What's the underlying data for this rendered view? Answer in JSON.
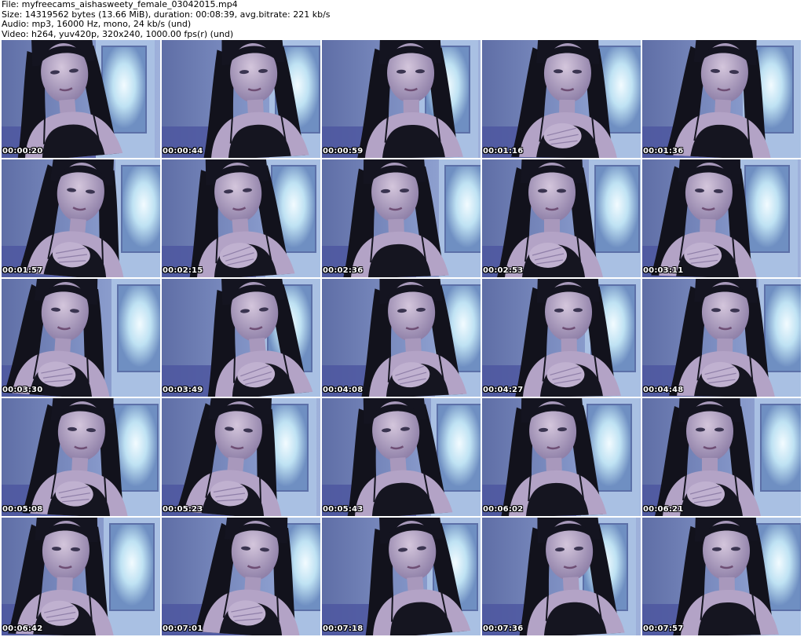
{
  "header": {
    "file_line": "File: myfreecams_aishasweety_female_03042015.mp4",
    "size_line": "Size: 14319562 bytes (13.66 MiB), duration: 00:08:39, avg.bitrate: 221 kb/s",
    "audio_line": "Audio: mp3, 16000 Hz, mono, 24 kb/s (und)",
    "video_line": "Video: h264, yuv420p, 320x240, 1000.00 fps(r) (und)"
  },
  "thumbnails": [
    {
      "timestamp": "00:00:20"
    },
    {
      "timestamp": "00:00:44"
    },
    {
      "timestamp": "00:00:59"
    },
    {
      "timestamp": "00:01:16"
    },
    {
      "timestamp": "00:01:36"
    },
    {
      "timestamp": "00:01:57"
    },
    {
      "timestamp": "00:02:15"
    },
    {
      "timestamp": "00:02:36"
    },
    {
      "timestamp": "00:02:53"
    },
    {
      "timestamp": "00:03:11"
    },
    {
      "timestamp": "00:03:30"
    },
    {
      "timestamp": "00:03:49"
    },
    {
      "timestamp": "00:04:08"
    },
    {
      "timestamp": "00:04:27"
    },
    {
      "timestamp": "00:04:48"
    },
    {
      "timestamp": "00:05:08"
    },
    {
      "timestamp": "00:05:23"
    },
    {
      "timestamp": "00:05:43"
    },
    {
      "timestamp": "00:06:02"
    },
    {
      "timestamp": "00:06:21"
    },
    {
      "timestamp": "00:06:42"
    },
    {
      "timestamp": "00:07:01"
    },
    {
      "timestamp": "00:07:18"
    },
    {
      "timestamp": "00:07:36"
    },
    {
      "timestamp": "00:07:57"
    }
  ],
  "colors": {
    "page_background": "#ffffff",
    "wall_blue": "#7d8fc4",
    "door_light": "#c8e6f5",
    "skin": "#b9a9c6",
    "hair": "#141420",
    "timestamp_text": "#ffffff"
  }
}
